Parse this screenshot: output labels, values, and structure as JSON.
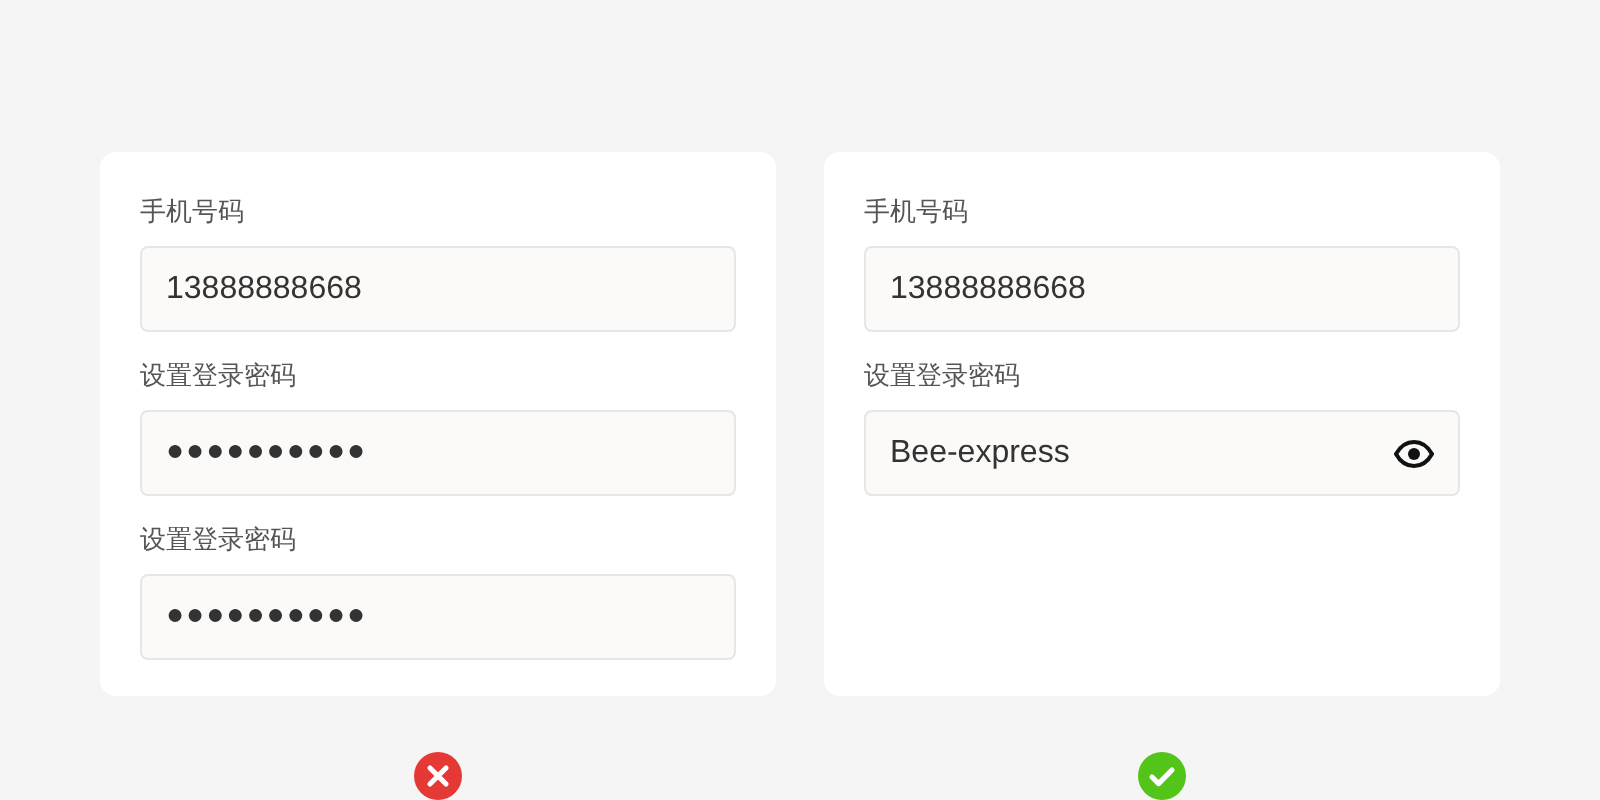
{
  "panels": [
    {
      "kind": "bad",
      "fields": [
        {
          "label": "手机号码",
          "kind": "text",
          "value": "13888888668"
        },
        {
          "label": "设置登录密码",
          "kind": "password",
          "value": "●●●●●●●●●●"
        },
        {
          "label": "设置登录密码",
          "kind": "password",
          "value": "●●●●●●●●●●"
        }
      ]
    },
    {
      "kind": "good",
      "fields": [
        {
          "label": "手机号码",
          "kind": "text",
          "value": "13888888668"
        },
        {
          "label": "设置登录密码",
          "kind": "revealed",
          "value": "Bee-express"
        }
      ]
    }
  ]
}
